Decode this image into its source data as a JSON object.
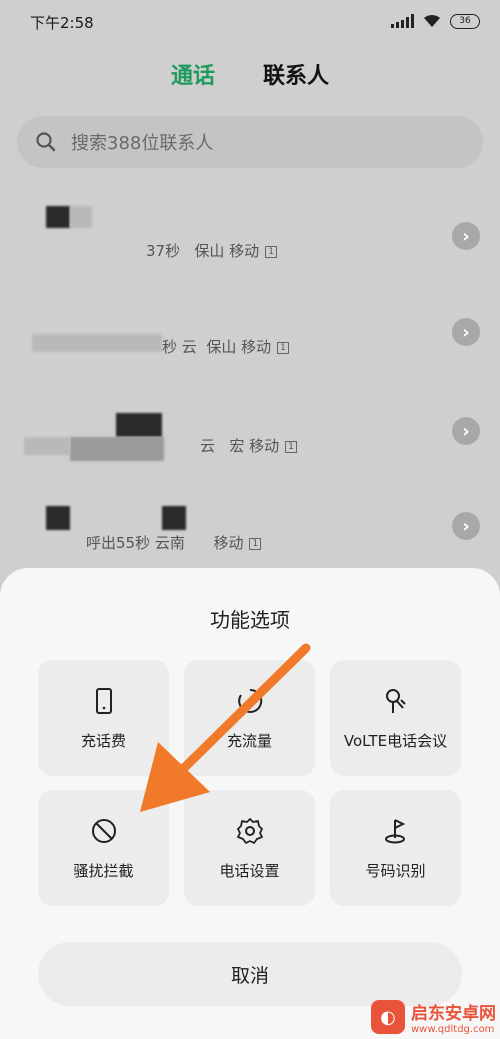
{
  "status": {
    "time": "下午2:58",
    "battery": "36"
  },
  "tabs": {
    "calls": "通话",
    "contacts": "联系人"
  },
  "search": {
    "placeholder": "搜索388位联系人"
  },
  "calls": [
    {
      "detail": "37秒",
      "location": "保山 移动"
    },
    {
      "detail": "秒 云",
      "location": "保山 移动"
    },
    {
      "detail": "云",
      "location": "宏 移动"
    },
    {
      "detail": "呼出55秒 云南",
      "location": "移动"
    }
  ],
  "sheet": {
    "title": "功能选项",
    "options": [
      {
        "label": "充话费",
        "icon": "phone-icon"
      },
      {
        "label": "充流量",
        "icon": "data-icon"
      },
      {
        "label": "VoLTE电话会议",
        "icon": "conference-icon"
      },
      {
        "label": "骚扰拦截",
        "icon": "block-icon"
      },
      {
        "label": "电话设置",
        "icon": "gear-icon"
      },
      {
        "label": "号码识别",
        "icon": "flag-icon"
      }
    ],
    "cancel": "取消"
  },
  "watermark": {
    "name": "启东安卓网",
    "url": "www.qdltdg.com"
  },
  "colors": {
    "accent": "#1f9a5e",
    "arrow": "#f07a2a"
  }
}
